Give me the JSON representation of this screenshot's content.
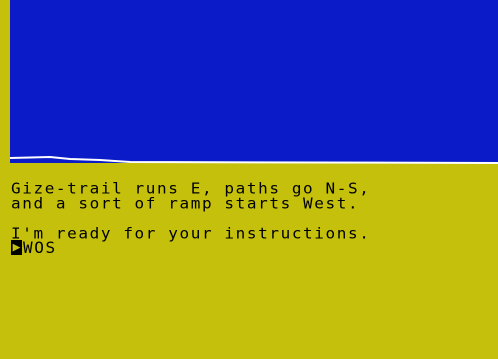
{
  "scene": {
    "sky_color": "#0a1bc7",
    "ground_color": "#c4c00c",
    "border_color": "#ffffff",
    "horizon_line_color": "#ffffff"
  },
  "text_window": {
    "lines": [
      "Gize-trail runs E, paths go N-S,",
      "and a sort of ramp starts West.",
      "I'm ready for your instructions."
    ],
    "cursor_glyph": "▶",
    "input_text": "WOS"
  }
}
